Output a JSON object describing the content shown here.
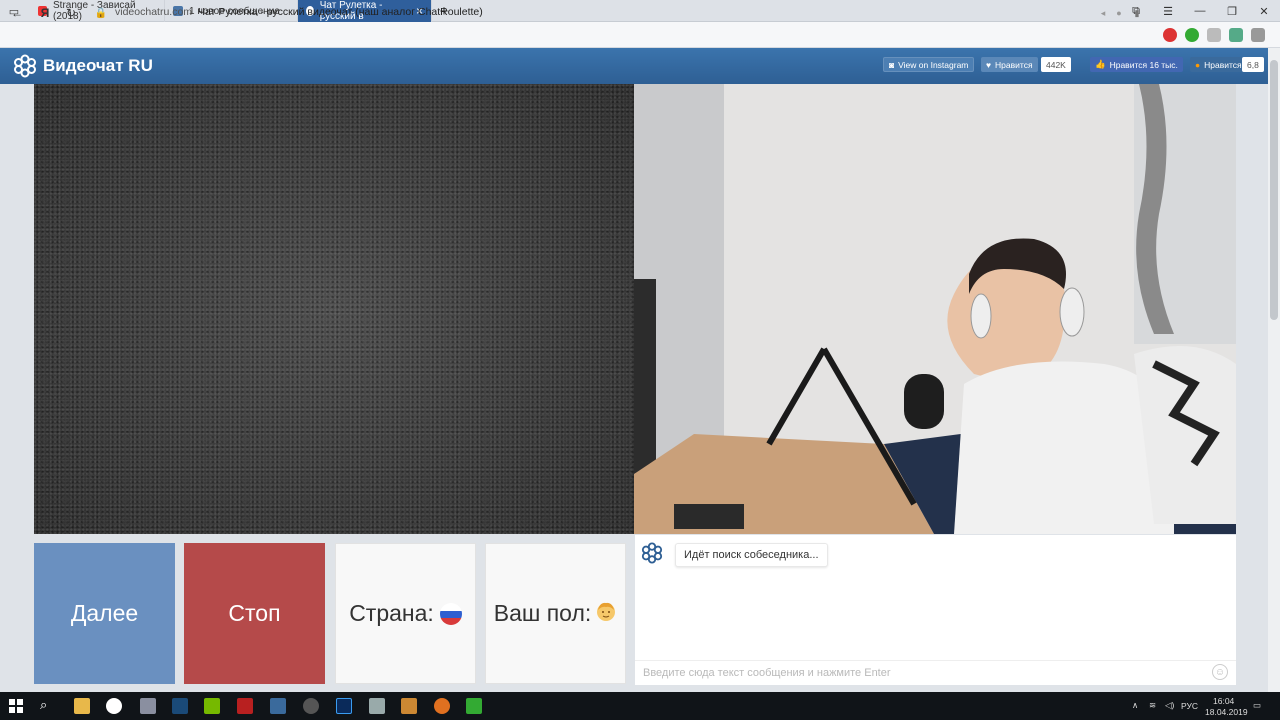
{
  "browser": {
    "tabs": [
      {
        "label": "Strange - Зависай (2018)"
      },
      {
        "label": "1 новое сообщение"
      },
      {
        "label": "Чат Рулетка - русский в"
      }
    ],
    "address": {
      "domain": "videochatru.com",
      "page_title": "Чат Рулетка - русский видеочат (наш аналог ChatRoulette)"
    }
  },
  "site": {
    "logo_text": "Видеочат RU",
    "header_buttons": {
      "instagram": "View on Instagram",
      "vk_like": "Нравится",
      "vk_count": "442K",
      "fb_like": "Нравится 16 тыс.",
      "ok_like": "Нравится",
      "ok_count": "6,8"
    },
    "controls": {
      "next": "Далее",
      "stop": "Стоп",
      "country": "Страна:",
      "gender": "Ваш пол:"
    },
    "chat": {
      "status": "Идёт поиск собеседника...",
      "input_placeholder": "Введите сюда текст сообщения и нажмите Enter"
    }
  },
  "taskbar": {
    "lang": "РУС",
    "time": "16:04",
    "date": "18.04.2019"
  },
  "colors": {
    "header": "#356aa0",
    "next_button": "#6a90c0",
    "stop_button": "#b54a4a"
  }
}
